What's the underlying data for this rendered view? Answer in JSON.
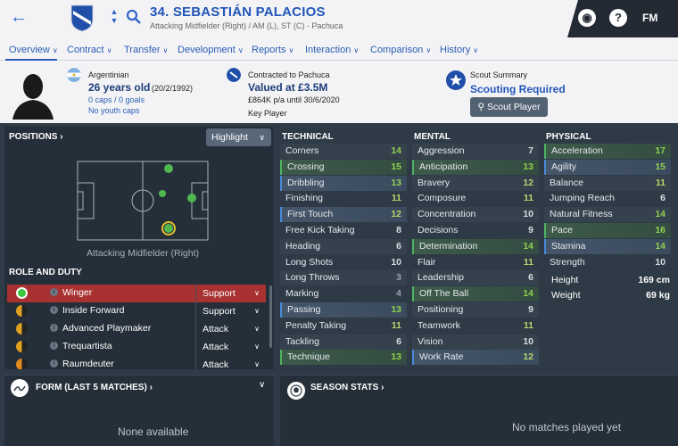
{
  "header": {
    "title": "34. SEBASTIÁN PALACIOS",
    "subtitle": "Attacking Midfielder (Right) / AM (L), ST (C) - Pachuca",
    "fm_label": "FM"
  },
  "nav": {
    "items": [
      "Overview",
      "Contract",
      "Transfer",
      "Development",
      "Reports",
      "Interaction",
      "Comparison",
      "History"
    ]
  },
  "profile": {
    "nationality": "Argentinian",
    "age": "26 years old",
    "dob": "(20/2/1992)",
    "caps": "0 caps / 0 goals",
    "youth_caps": "No youth caps",
    "contract_to": "Contracted to Pachuca",
    "value": "Valued at £3.5M",
    "wage": "£864K p/a until 30/6/2020",
    "squad_status": "Key Player",
    "scout_title": "Scout Summary",
    "scout_status": "Scouting Required",
    "scout_button": "Scout Player"
  },
  "positions": {
    "title": "POSITIONS",
    "highlight_label": "Highlight",
    "pitch_label": "Attacking Midfielder (Right)"
  },
  "roles": {
    "title": "ROLE AND DUTY",
    "items": [
      {
        "name": "Winger",
        "duty": "Support",
        "color": "#3cc83c"
      },
      {
        "name": "Inside Forward",
        "duty": "Support",
        "color": "#e0a020"
      },
      {
        "name": "Advanced Playmaker",
        "duty": "Attack",
        "color": "#e0a020"
      },
      {
        "name": "Trequartista",
        "duty": "Attack",
        "color": "#e0a020"
      },
      {
        "name": "Raumdeuter",
        "duty": "Attack",
        "color": "#e08a20"
      }
    ]
  },
  "technical": {
    "title": "TECHNICAL",
    "items": [
      {
        "name": "Corners",
        "value": "14"
      },
      {
        "name": "Crossing",
        "value": "15"
      },
      {
        "name": "Dribbling",
        "value": "13"
      },
      {
        "name": "Finishing",
        "value": "11"
      },
      {
        "name": "First Touch",
        "value": "12"
      },
      {
        "name": "Free Kick Taking",
        "value": "8"
      },
      {
        "name": "Heading",
        "value": "6"
      },
      {
        "name": "Long Shots",
        "value": "10"
      },
      {
        "name": "Long Throws",
        "value": "3"
      },
      {
        "name": "Marking",
        "value": "4"
      },
      {
        "name": "Passing",
        "value": "13"
      },
      {
        "name": "Penalty Taking",
        "value": "11"
      },
      {
        "name": "Tackling",
        "value": "6"
      },
      {
        "name": "Technique",
        "value": "13"
      }
    ]
  },
  "mental": {
    "title": "MENTAL",
    "items": [
      {
        "name": "Aggression",
        "value": "7"
      },
      {
        "name": "Anticipation",
        "value": "13"
      },
      {
        "name": "Bravery",
        "value": "12"
      },
      {
        "name": "Composure",
        "value": "11"
      },
      {
        "name": "Concentration",
        "value": "10"
      },
      {
        "name": "Decisions",
        "value": "9"
      },
      {
        "name": "Determination",
        "value": "14"
      },
      {
        "name": "Flair",
        "value": "11"
      },
      {
        "name": "Leadership",
        "value": "6"
      },
      {
        "name": "Off The Ball",
        "value": "14"
      },
      {
        "name": "Positioning",
        "value": "9"
      },
      {
        "name": "Teamwork",
        "value": "11"
      },
      {
        "name": "Vision",
        "value": "10"
      },
      {
        "name": "Work Rate",
        "value": "12"
      }
    ]
  },
  "physical": {
    "title": "PHYSICAL",
    "items": [
      {
        "name": "Acceleration",
        "value": "17"
      },
      {
        "name": "Agility",
        "value": "15"
      },
      {
        "name": "Balance",
        "value": "11"
      },
      {
        "name": "Jumping Reach",
        "value": "6"
      },
      {
        "name": "Natural Fitness",
        "value": "14"
      },
      {
        "name": "Pace",
        "value": "16"
      },
      {
        "name": "Stamina",
        "value": "14"
      },
      {
        "name": "Strength",
        "value": "10"
      }
    ],
    "height_label": "Height",
    "height": "169 cm",
    "weight_label": "Weight",
    "weight": "69 kg"
  },
  "form": {
    "title": "FORM (LAST 5 MATCHES)",
    "empty": "None available"
  },
  "season": {
    "title": "SEASON STATS",
    "empty": "No matches played yet"
  }
}
